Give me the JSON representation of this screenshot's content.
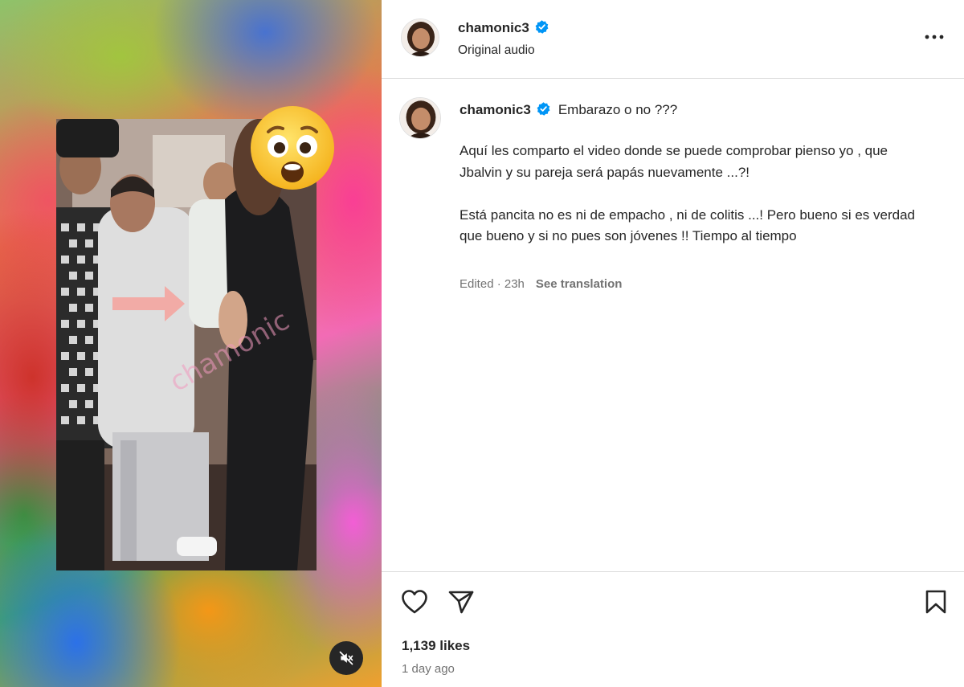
{
  "post": {
    "username": "chamonic3",
    "audio_label": "Original audio",
    "caption_title": "Embarazo o no ???",
    "caption_paragraphs": [
      "Aquí les comparto el video donde se puede comprobar pienso yo , que Jbalvin y su pareja será papás nuevamente ...?!",
      "Está pancita no es ni de empacho , ni de colitis ...! Pero bueno si es verdad que bueno y si no pues son jóvenes !! Tiempo al tiempo"
    ],
    "edited_label": "Edited · 23h",
    "see_translation": "See translation",
    "likes": "1,139 likes",
    "time_ago": "1 day ago"
  },
  "colors": {
    "verified": "#0095f6",
    "text": "#262626",
    "muted": "#737373",
    "divider": "#dbdbdb"
  },
  "icons": [
    "verified-badge-icon",
    "more-options-icon",
    "heart-icon",
    "share-icon",
    "bookmark-icon",
    "mute-icon",
    "surprised-emoji"
  ]
}
